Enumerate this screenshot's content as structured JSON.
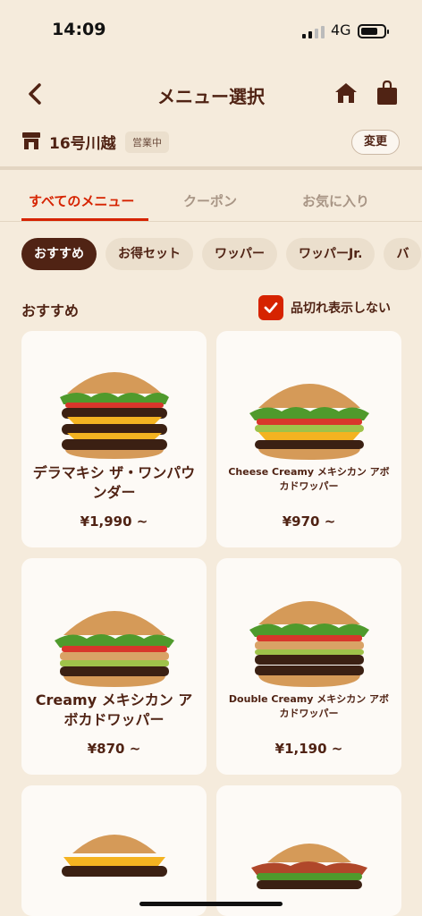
{
  "status_bar": {
    "time": "14:09",
    "network": "4G"
  },
  "header": {
    "title": "メニュー選択",
    "icons": [
      "back-icon",
      "home-icon",
      "bag-icon"
    ]
  },
  "store": {
    "name": "16号川越",
    "status": "営業中",
    "change_label": "変更"
  },
  "tabs": [
    {
      "label": "すべてのメニュー",
      "active": true
    },
    {
      "label": "クーポン",
      "active": false
    },
    {
      "label": "お気に入り",
      "active": false
    }
  ],
  "chips": [
    {
      "label": "おすすめ",
      "active": true
    },
    {
      "label": "お得セット",
      "active": false
    },
    {
      "label": "ワッパー",
      "active": false
    },
    {
      "label": "ワッパーJr.",
      "active": false
    },
    {
      "label": "バ",
      "active": false
    }
  ],
  "section": {
    "title": "おすすめ",
    "soldout_label": "品切れ表示しない",
    "soldout_checked": true
  },
  "items": [
    {
      "name": "デラマキシ ザ・ワンパウンダー",
      "price": "¥1,990 ~"
    },
    {
      "name": "Cheese Creamy メキシカン アボカドワッパー",
      "price": "¥970 ~"
    },
    {
      "name": "Creamy メキシカン アボカドワッパー",
      "price": "¥870 ~"
    },
    {
      "name": "Double Creamy メキシカン アボカドワッパー",
      "price": "¥1,190 ~"
    },
    {
      "name": "",
      "price": ""
    },
    {
      "name": "",
      "price": ""
    }
  ],
  "colors": {
    "background": "#f5ebdc",
    "brand_brown": "#502314",
    "accent_red": "#d62300",
    "card": "#fdfaf6"
  }
}
